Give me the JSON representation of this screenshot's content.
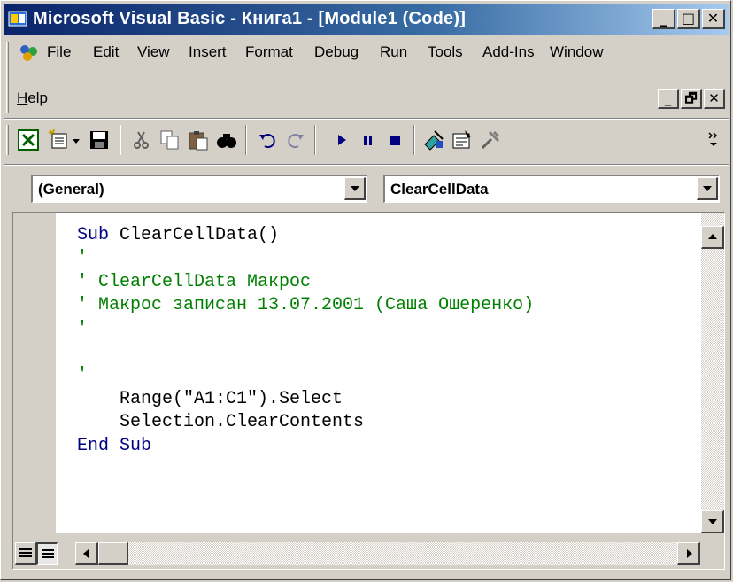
{
  "window": {
    "title": "Microsoft Visual Basic - Книга1 - [Module1 (Code)]",
    "minimize": "_",
    "maximize": "□",
    "close": "✕"
  },
  "menu": {
    "items": [
      {
        "label": "File",
        "accel": "F",
        "rest": "ile"
      },
      {
        "label": "Edit",
        "accel": "E",
        "rest": "dit"
      },
      {
        "label": "View",
        "accel": "V",
        "rest": "iew"
      },
      {
        "label": "Insert",
        "accel": "I",
        "rest": "nsert"
      },
      {
        "label": "Format",
        "pre": "F",
        "accel": "o",
        "rest": "rmat"
      },
      {
        "label": "Debug",
        "accel": "D",
        "rest": "ebug"
      },
      {
        "label": "Run",
        "accel": "R",
        "rest": "un"
      },
      {
        "label": "Tools",
        "accel": "T",
        "rest": "ools"
      },
      {
        "label": "Add-Ins",
        "accel": "A",
        "rest": "dd-Ins"
      },
      {
        "label": "Window",
        "accel": "W",
        "rest": "indow"
      },
      {
        "label": "Help",
        "accel": "H",
        "rest": "elp"
      }
    ],
    "mdi_minimize": "_",
    "mdi_restore": "🗗",
    "mdi_close": "✕"
  },
  "toolbar": {
    "icons": [
      "excel-icon",
      "insert-module-icon",
      "dropdown-arrow-icon",
      "save-icon",
      "cut-icon",
      "copy-icon",
      "paste-icon",
      "find-icon",
      "undo-icon",
      "redo-icon",
      "run-icon",
      "break-icon",
      "reset-icon",
      "design-mode-icon",
      "properties-icon",
      "toolbox-icon",
      "toolbar-options-icon"
    ]
  },
  "code_window": {
    "object_combo": "(General)",
    "procedure_combo": "ClearCellData",
    "lines": [
      [
        {
          "t": "Sub",
          "c": "kw"
        },
        {
          "t": " ClearCellData()",
          "c": ""
        }
      ],
      [
        {
          "t": "'",
          "c": "cm"
        }
      ],
      [
        {
          "t": "' ClearCellData Макрос",
          "c": "cm"
        }
      ],
      [
        {
          "t": "' Макрос записан 13.07.2001 (Саша Ошеренко)",
          "c": "cm"
        }
      ],
      [
        {
          "t": "'",
          "c": "cm"
        }
      ],
      [
        {
          "t": "",
          "c": ""
        }
      ],
      [
        {
          "t": "'",
          "c": "cm"
        }
      ],
      [
        {
          "t": "    Range(\"A1:C1\").Select",
          "c": ""
        }
      ],
      [
        {
          "t": "    Selection.ClearContents",
          "c": ""
        }
      ],
      [
        {
          "t": "End Sub",
          "c": "kw"
        }
      ]
    ]
  },
  "colors": {
    "keyword": "#000080",
    "comment": "#008000",
    "titlebar_start": "#0a246a",
    "titlebar_end": "#a6caf0"
  }
}
